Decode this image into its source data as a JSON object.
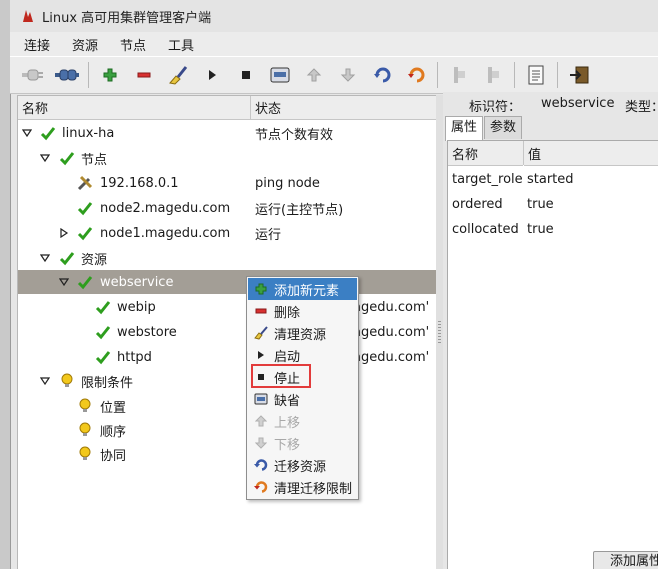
{
  "window": {
    "title": "Linux 高可用集群管理客户端"
  },
  "menu": [
    "连接",
    "资源",
    "节点",
    "工具"
  ],
  "tree": {
    "columns": {
      "name": "名称",
      "status": "状态"
    },
    "rows": [
      {
        "label": "linux-ha",
        "status": "节点个数有效"
      },
      {
        "label": "节点",
        "status": ""
      },
      {
        "label": "192.168.0.1",
        "status": "ping node"
      },
      {
        "label": "node2.magedu.com",
        "status": "运行(主控节点)"
      },
      {
        "label": "node1.magedu.com",
        "status": "运行"
      },
      {
        "label": "资源",
        "status": ""
      },
      {
        "label": "webservice",
        "status": ""
      },
      {
        "label": "webip",
        "status": "agedu.com'"
      },
      {
        "label": "webstore",
        "status": "agedu.com'"
      },
      {
        "label": "httpd",
        "status": "agedu.com'"
      },
      {
        "label": "限制条件",
        "status": ""
      },
      {
        "label": "位置",
        "status": ""
      },
      {
        "label": "顺序",
        "status": ""
      },
      {
        "label": "协同",
        "status": ""
      }
    ]
  },
  "identifier": {
    "label": "标识符：",
    "value": "webservice",
    "type_label": "类型："
  },
  "tabs": [
    "属性",
    "参数"
  ],
  "props": {
    "columns": {
      "name": "名称",
      "value": "值"
    },
    "rows": [
      {
        "name": "target_role",
        "value": "started"
      },
      {
        "name": "ordered",
        "value": "true"
      },
      {
        "name": "collocated",
        "value": "true"
      }
    ]
  },
  "context_menu": [
    {
      "label": "添加新元素",
      "icon": "plus-icon"
    },
    {
      "label": "删除",
      "icon": "minus-icon"
    },
    {
      "label": "清理资源",
      "icon": "broom-icon"
    },
    {
      "label": "启动",
      "icon": "play-icon"
    },
    {
      "label": "停止",
      "icon": "stop-icon"
    },
    {
      "label": "缺省",
      "icon": "default-icon"
    },
    {
      "label": "上移",
      "icon": "up-arrow-icon"
    },
    {
      "label": "下移",
      "icon": "down-arrow-icon"
    },
    {
      "label": "迁移资源",
      "icon": "migrate-icon"
    },
    {
      "label": "清理迁移限制",
      "icon": "clear-migrate-icon"
    }
  ],
  "buttons": {
    "add_attr": "添加属性"
  },
  "colors": {
    "selection": "#a39e96",
    "menu_highlight": "#3b7fc4",
    "check_green": "#2e9e1e",
    "highlight_box": "#e23b3b"
  }
}
